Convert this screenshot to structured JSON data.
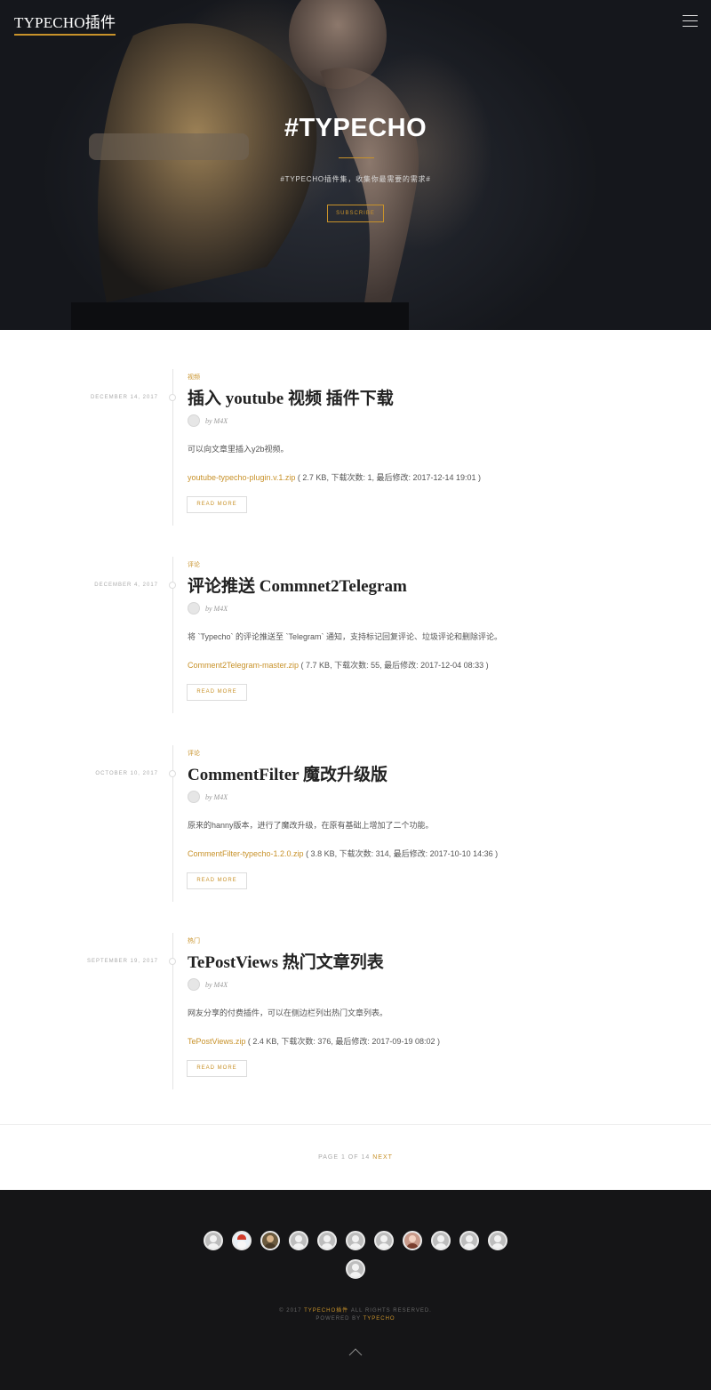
{
  "site": {
    "logo": "TYPECHO插件",
    "hero_title": "#TYPECHO",
    "hero_subtitle": "#TYPECHO插件集，收集你最需要的需求#",
    "subscribe_label": "SUBSCRIBE"
  },
  "colors": {
    "accent": "#c8922a",
    "footer_bg": "#151517",
    "hero_bg": "#14161b"
  },
  "posts": [
    {
      "date": "DECEMBER 14, 2017",
      "category": "视频",
      "title": "插入 youtube 视频 插件下载",
      "author": "by M4X",
      "excerpt": "可以向文章里插入y2b视频。",
      "attachment_name": "youtube-typecho-plugin.v.1.zip",
      "attachment_meta": " ( 2.7 KB, 下载次数: 1, 最后修改: 2017-12-14 19:01 )",
      "read_more": "READ MORE"
    },
    {
      "date": "DECEMBER 4, 2017",
      "category": "评论",
      "title": "评论推送 Commnet2Telegram",
      "author": "by M4X",
      "excerpt": "将 `Typecho` 的评论推送至 `Telegram` 通知，支持标记回复评论、垃圾评论和删除评论。",
      "attachment_name": "Comment2Telegram-master.zip",
      "attachment_meta": " ( 7.7 KB, 下载次数: 55, 最后修改: 2017-12-04 08:33 )",
      "read_more": "READ MORE"
    },
    {
      "date": "OCTOBER 10, 2017",
      "category": "评论",
      "title": "CommentFilter 魔改升级版",
      "author": "by M4X",
      "excerpt": "原来的hanny版本，进行了魔改升级，在原有基础上增加了二个功能。",
      "attachment_name": "CommentFilter-typecho-1.2.0.zip",
      "attachment_meta": " ( 3.8 KB, 下载次数: 314, 最后修改: 2017-10-10 14:36 )",
      "read_more": "READ MORE"
    },
    {
      "date": "SEPTEMBER 19, 2017",
      "category": "热门",
      "title": "TePostViews 热门文章列表",
      "author": "by M4X",
      "excerpt": "网友分享的付费插件，可以在侧边栏列出热门文章列表。",
      "attachment_name": "TePostViews.zip",
      "attachment_meta": " ( 2.4 KB, 下载次数: 376, 最后修改: 2017-09-19 08:02 )",
      "read_more": "READ MORE"
    }
  ],
  "pagination": {
    "text": "PAGE 1 OF 14",
    "next": "NEXT"
  },
  "footer": {
    "copyright_prefix": "© 2017",
    "copyright_brand": "TYPECHO插件",
    "copyright_suffix": "ALL RIGHTS RESERVED.",
    "powered_prefix": "POWERED BY",
    "powered_brand": "TYPECHO",
    "avatar_icons": [
      "user-icon",
      "santa-icon",
      "photo-icon",
      "user-icon",
      "user-icon",
      "user-icon",
      "user-icon",
      "girl-photo-icon",
      "user-icon",
      "user-icon",
      "user-icon",
      "user-icon"
    ]
  }
}
